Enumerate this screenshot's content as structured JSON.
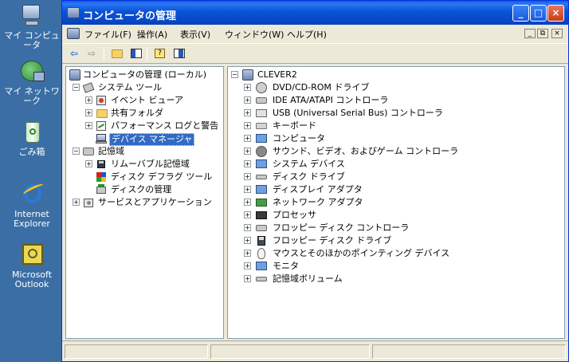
{
  "desktop": {
    "icons": [
      {
        "label": "マイ コンピュータ",
        "icon": "my-computer-icon"
      },
      {
        "label": "マイ ネットワーク",
        "icon": "network-places-icon"
      },
      {
        "label": "ごみ箱",
        "icon": "recycle-bin-icon"
      },
      {
        "label": "Internet Explorer",
        "icon": "internet-explorer-icon"
      },
      {
        "label": "Microsoft Outlook",
        "icon": "outlook-icon"
      }
    ]
  },
  "window": {
    "title": "コンピュータの管理",
    "controls": {
      "minimize": "_",
      "maximize": "□",
      "close": "×"
    }
  },
  "menubar": {
    "items": [
      "ファイル(F)",
      "操作(A)",
      "表示(V)",
      "ウィンドウ(W)",
      "ヘルプ(H)"
    ],
    "mdi_controls": [
      "_",
      "⧉",
      "×"
    ]
  },
  "toolbar": {
    "buttons": [
      "back-icon",
      "forward-icon",
      "up-folder-icon",
      "show-hide-tree-icon",
      "help-icon",
      "properties-icon"
    ]
  },
  "tree": {
    "root": "コンピュータの管理 (ローカル)",
    "system_tools": "システム ツール",
    "event_viewer": "イベント ビューア",
    "shared_folders": "共有フォルダ",
    "perf_logs": "パフォーマンス ログと警告",
    "device_manager": "デバイス マネージャ",
    "storage": "記憶域",
    "removable": "リムーバブル記憶域",
    "defrag": "ディスク デフラグ ツール",
    "disk_mgmt": "ディスクの管理",
    "services": "サービスとアプリケーション"
  },
  "devices": {
    "computer_name": "CLEVER2",
    "items": [
      "DVD/CD-ROM ドライブ",
      "IDE ATA/ATAPI コントローラ",
      "USB (Universal Serial Bus) コントローラ",
      "キーボード",
      "コンピュータ",
      "サウンド、ビデオ、およびゲーム コントローラ",
      "システム デバイス",
      "ディスク ドライブ",
      "ディスプレイ アダプタ",
      "ネットワーク アダプタ",
      "プロセッサ",
      "フロッピー ディスク コントローラ",
      "フロッピー ディスク ドライブ",
      "マウスとそのほかのポインティング デバイス",
      "モニタ",
      "記憶域ボリューム"
    ]
  },
  "colors": {
    "desktop": "#3a6ea5",
    "titlebar": "#0a53d6",
    "selection": "#316ac5"
  }
}
